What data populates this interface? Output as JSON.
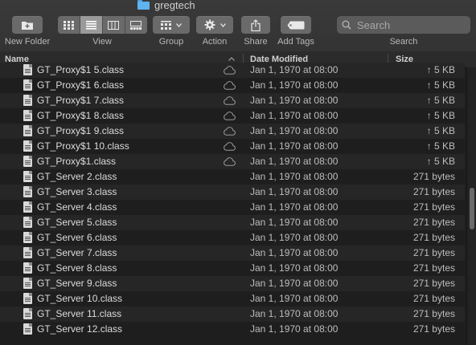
{
  "window": {
    "title": "gregtech"
  },
  "toolbar": {
    "new_folder_label": "New Folder",
    "view_label": "View",
    "group_label": "Group",
    "action_label": "Action",
    "share_label": "Share",
    "add_tags_label": "Add Tags",
    "search_label": "Search",
    "search_placeholder": "Search"
  },
  "columns": {
    "name": "Name",
    "date_modified": "Date Modified",
    "size": "Size"
  },
  "files": [
    {
      "name": "GT_Proxy$1 5.class",
      "date": "Jan 1, 1970 at 08:00",
      "size": "↑ 5 KB",
      "cloud": true
    },
    {
      "name": "GT_Proxy$1 6.class",
      "date": "Jan 1, 1970 at 08:00",
      "size": "↑ 5 KB",
      "cloud": true
    },
    {
      "name": "GT_Proxy$1 7.class",
      "date": "Jan 1, 1970 at 08:00",
      "size": "↑ 5 KB",
      "cloud": true
    },
    {
      "name": "GT_Proxy$1 8.class",
      "date": "Jan 1, 1970 at 08:00",
      "size": "↑ 5 KB",
      "cloud": true
    },
    {
      "name": "GT_Proxy$1 9.class",
      "date": "Jan 1, 1970 at 08:00",
      "size": "↑ 5 KB",
      "cloud": true
    },
    {
      "name": "GT_Proxy$1 10.class",
      "date": "Jan 1, 1970 at 08:00",
      "size": "↑ 5 KB",
      "cloud": true
    },
    {
      "name": "GT_Proxy$1.class",
      "date": "Jan 1, 1970 at 08:00",
      "size": "↑ 5 KB",
      "cloud": true
    },
    {
      "name": "GT_Server 2.class",
      "date": "Jan 1, 1970 at 08:00",
      "size": "271 bytes",
      "cloud": false
    },
    {
      "name": "GT_Server 3.class",
      "date": "Jan 1, 1970 at 08:00",
      "size": "271 bytes",
      "cloud": false
    },
    {
      "name": "GT_Server 4.class",
      "date": "Jan 1, 1970 at 08:00",
      "size": "271 bytes",
      "cloud": false
    },
    {
      "name": "GT_Server 5.class",
      "date": "Jan 1, 1970 at 08:00",
      "size": "271 bytes",
      "cloud": false
    },
    {
      "name": "GT_Server 6.class",
      "date": "Jan 1, 1970 at 08:00",
      "size": "271 bytes",
      "cloud": false
    },
    {
      "name": "GT_Server 7.class",
      "date": "Jan 1, 1970 at 08:00",
      "size": "271 bytes",
      "cloud": false
    },
    {
      "name": "GT_Server 8.class",
      "date": "Jan 1, 1970 at 08:00",
      "size": "271 bytes",
      "cloud": false
    },
    {
      "name": "GT_Server 9.class",
      "date": "Jan 1, 1970 at 08:00",
      "size": "271 bytes",
      "cloud": false
    },
    {
      "name": "GT_Server 10.class",
      "date": "Jan 1, 1970 at 08:00",
      "size": "271 bytes",
      "cloud": false
    },
    {
      "name": "GT_Server 11.class",
      "date": "Jan 1, 1970 at 08:00",
      "size": "271 bytes",
      "cloud": false
    },
    {
      "name": "GT_Server 12.class",
      "date": "Jan 1, 1970 at 08:00",
      "size": "271 bytes",
      "cloud": false
    }
  ]
}
